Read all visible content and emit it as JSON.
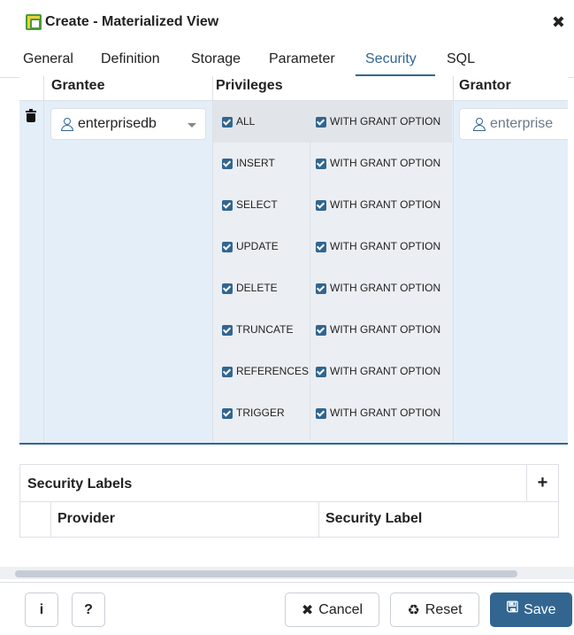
{
  "window": {
    "title": "Create - Materialized View",
    "close_icon": "close-icon"
  },
  "tabs": [
    {
      "label": "General"
    },
    {
      "label": "Definition"
    },
    {
      "label": "Storage"
    },
    {
      "label": "Parameter"
    },
    {
      "label": "Security",
      "active": true
    },
    {
      "label": "SQL"
    }
  ],
  "privileges_grid": {
    "headers": {
      "grantee": "Grantee",
      "privileges": "Privileges",
      "grantor": "Grantor"
    },
    "row": {
      "grantee": "enterprisedb",
      "grantor": "enterprise",
      "privileges": [
        {
          "name": "ALL",
          "checked": true,
          "grant_option": "WITH GRANT OPTION",
          "grant_checked": true
        },
        {
          "name": "INSERT",
          "checked": true,
          "grant_option": "WITH GRANT OPTION",
          "grant_checked": true
        },
        {
          "name": "SELECT",
          "checked": true,
          "grant_option": "WITH GRANT OPTION",
          "grant_checked": true
        },
        {
          "name": "UPDATE",
          "checked": true,
          "grant_option": "WITH GRANT OPTION",
          "grant_checked": true
        },
        {
          "name": "DELETE",
          "checked": true,
          "grant_option": "WITH GRANT OPTION",
          "grant_checked": true
        },
        {
          "name": "TRUNCATE",
          "checked": true,
          "grant_option": "WITH GRANT OPTION",
          "grant_checked": true
        },
        {
          "name": "REFERENCES",
          "checked": true,
          "grant_option": "WITH GRANT OPTION",
          "grant_checked": true
        },
        {
          "name": "TRIGGER",
          "checked": true,
          "grant_option": "WITH GRANT OPTION",
          "grant_checked": true
        }
      ]
    }
  },
  "security_labels": {
    "title": "Security Labels",
    "add_label": "+",
    "columns": {
      "provider": "Provider",
      "label": "Security Label"
    }
  },
  "footer": {
    "info_label": "i",
    "help_label": "?",
    "cancel_label": "Cancel",
    "reset_label": "Reset",
    "save_label": "Save"
  },
  "colors": {
    "accent": "#326690",
    "row_highlight": "#e4eef8"
  }
}
